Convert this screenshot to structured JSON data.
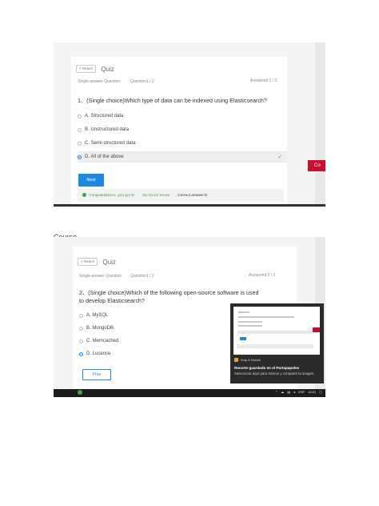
{
  "screenshot1": {
    "return_label": "< Return",
    "quiz_title": "Quiz",
    "question_type": "Single-answer Question",
    "question_counter": "Question1 / 2",
    "answered": "Answered 2 / 2",
    "question_text": "1、(Single choice)Which type of data can be indexed using Elasticsearch?",
    "options": [
      {
        "label": "A. Structured data",
        "selected": false
      },
      {
        "label": "B. Unstructured data",
        "selected": false
      },
      {
        "label": "C. Semi-structured data",
        "selected": false
      },
      {
        "label": "D. All of the above",
        "selected": true
      }
    ],
    "next_label": "Next",
    "result": {
      "congrats": "Congratulations, you got it!",
      "score": "My Score:Score",
      "correct": "Correct answer:D"
    },
    "side_tab_label": "Co"
  },
  "course_label": "Course",
  "screenshot2": {
    "return_label": "< Return",
    "quiz_title": "Quiz",
    "question_type": "Single-answer Question",
    "question_counter": "Question1 / 2",
    "answered": "Answered 2 / 2",
    "question_text": "2、(Single choice)Which of the following open-source software is used to develop Elasticsearch?",
    "options": [
      {
        "label": "A. MySQL",
        "selected": false
      },
      {
        "label": "B. MongoDB",
        "selected": false
      },
      {
        "label": "C. Memcached",
        "selected": false
      },
      {
        "label": "D. Lucence",
        "selected": true
      }
    ],
    "prev_label": "Prev",
    "toast": {
      "app_name": "Snip & Sketch",
      "title": "Recorte guardado en el Portapapeles",
      "body": "Selecciona aquí para marcar y compartir la imagen."
    },
    "taskbar": {
      "lang": "ESP",
      "time": "13:01"
    }
  },
  "colors": {
    "accent": "#1e88e5",
    "success": "#3fa34d",
    "red": "#c8102e"
  }
}
